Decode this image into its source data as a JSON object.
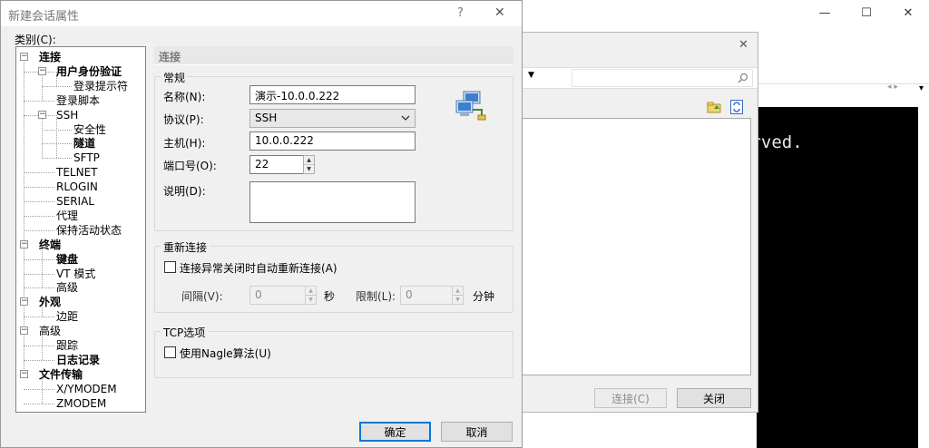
{
  "main_window": {
    "minimize": "—",
    "maximize": "☐",
    "close": "✕",
    "terminal_text": "erved."
  },
  "mid_dialog": {
    "close": "✕",
    "search_icon": "search-icon",
    "connect_btn": "连接(C)",
    "close_btn": "关闭"
  },
  "dialog": {
    "title": "新建会话属性",
    "help_btn": "?",
    "close_btn": "✕",
    "category_label": "类别(C):",
    "section_title": "连接",
    "group_general": "常规",
    "name_label": "名称(N):",
    "name_value": "演示-10.0.0.222",
    "protocol_label": "协议(P):",
    "protocol_value": "SSH",
    "host_label": "主机(H):",
    "host_value": "10.0.0.222",
    "port_label": "端口号(O):",
    "port_value": "22",
    "desc_label": "说明(D):",
    "desc_value": "",
    "group_reconnect": "重新连接",
    "reconnect_chk": "连接异常关闭时自动重新连接(A)",
    "interval_label": "间隔(V):",
    "interval_value": "0",
    "interval_unit": "秒",
    "limit_label": "限制(L):",
    "limit_value": "0",
    "limit_unit": "分钟",
    "group_tcp": "TCP选项",
    "nagle_chk": "使用Nagle算法(U)",
    "ok_btn": "确定",
    "cancel_btn": "取消"
  },
  "tree": {
    "items": [
      {
        "label": "连接",
        "bold": true
      },
      {
        "label": "用户身份验证",
        "bold": true
      },
      {
        "label": "登录提示符",
        "bold": false
      },
      {
        "label": "登录脚本",
        "bold": false
      },
      {
        "label": "SSH",
        "bold": false
      },
      {
        "label": "安全性",
        "bold": false
      },
      {
        "label": "隧道",
        "bold": true
      },
      {
        "label": "SFTP",
        "bold": false
      },
      {
        "label": "TELNET",
        "bold": false
      },
      {
        "label": "RLOGIN",
        "bold": false
      },
      {
        "label": "SERIAL",
        "bold": false
      },
      {
        "label": "代理",
        "bold": false
      },
      {
        "label": "保持活动状态",
        "bold": false
      },
      {
        "label": "终端",
        "bold": true
      },
      {
        "label": "键盘",
        "bold": true
      },
      {
        "label": "VT 模式",
        "bold": false
      },
      {
        "label": "高级",
        "bold": false
      },
      {
        "label": "外观",
        "bold": true
      },
      {
        "label": "边距",
        "bold": false
      },
      {
        "label": "高级",
        "bold": false
      },
      {
        "label": "跟踪",
        "bold": false
      },
      {
        "label": "日志记录",
        "bold": true
      },
      {
        "label": "文件传输",
        "bold": true
      },
      {
        "label": "X/YMODEM",
        "bold": false
      },
      {
        "label": "ZMODEM",
        "bold": false
      }
    ]
  },
  "colors": {
    "dialog_bg": "#f0f0f0",
    "terminal_bg": "#000000",
    "focus_border": "#0078d7"
  }
}
